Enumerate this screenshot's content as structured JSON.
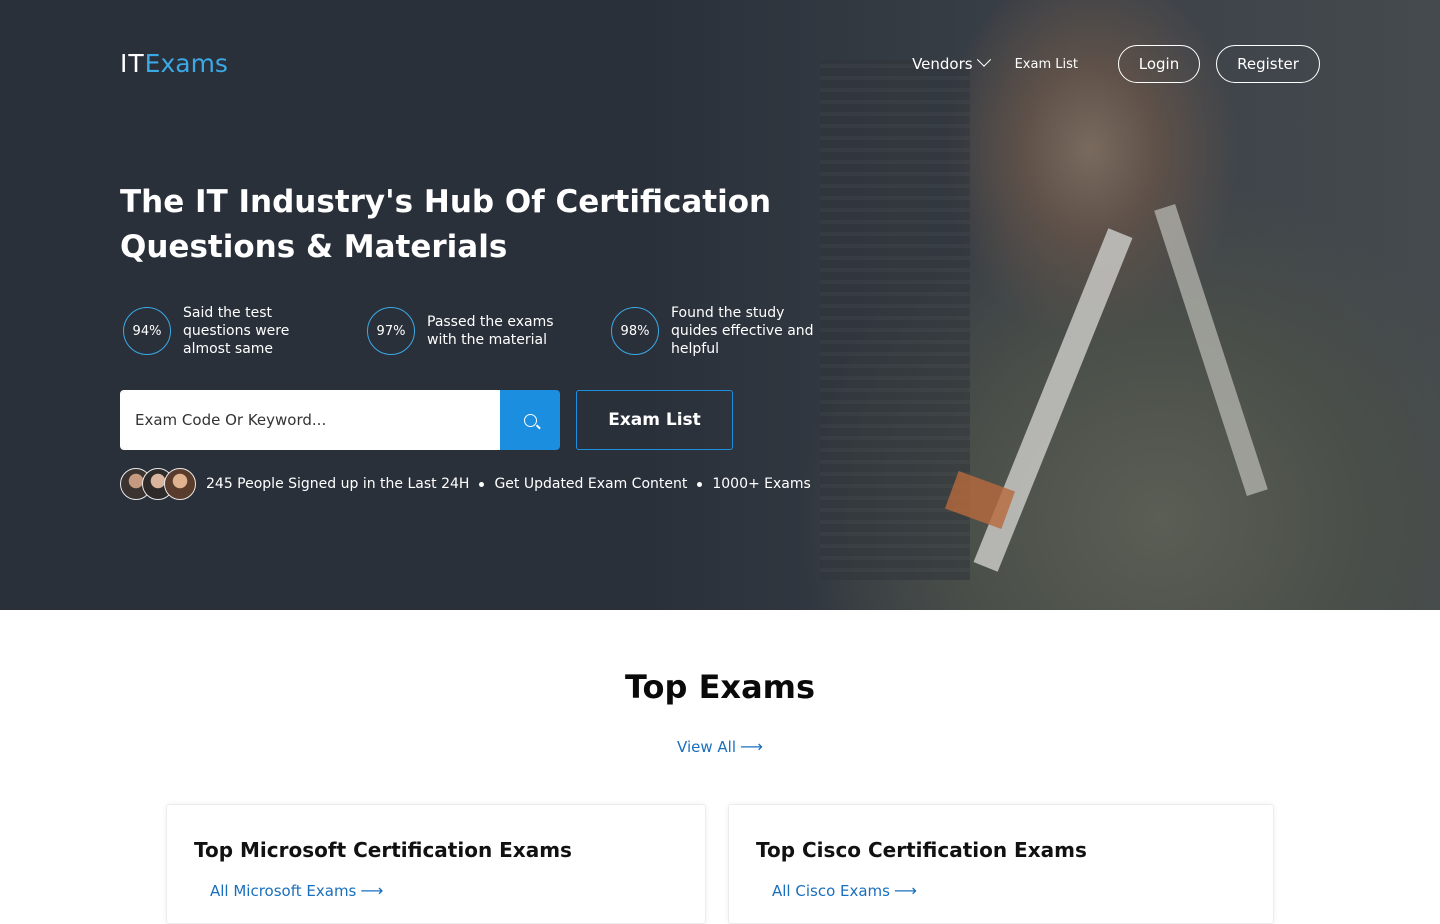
{
  "header": {
    "logo_it": "IT",
    "logo_exams": "Exams",
    "nav": {
      "vendors": "Vendors",
      "exam_list": "Exam List",
      "login": "Login",
      "register": "Register"
    }
  },
  "hero": {
    "headline": "The IT Industry's Hub Of Certification Questions & Materials",
    "stats": [
      {
        "percent": "94%",
        "text": "Said the test questions were almost same"
      },
      {
        "percent": "97%",
        "text": "Passed the exams with the material"
      },
      {
        "percent": "98%",
        "text": "Found the study quides effective and helpful"
      }
    ],
    "search": {
      "placeholder": "Exam Code Or Keyword...",
      "icon": "search-icon"
    },
    "exam_list_button": "Exam List",
    "social": {
      "signed_up": "245 People Signed up in the Last 24H",
      "updated": "Get Updated Exam Content",
      "count": "1000+ Exams"
    }
  },
  "top_exams": {
    "title": "Top Exams",
    "view_all": "View All",
    "cards": [
      {
        "title": "Top Microsoft Certification Exams",
        "link": "All Microsoft Exams"
      },
      {
        "title": "Top Cisco Certification Exams",
        "link": "All Cisco Exams"
      }
    ]
  },
  "colors": {
    "accent": "#1c8ee0",
    "hero_bg": "#2a303a",
    "link": "#1a6fbd"
  }
}
